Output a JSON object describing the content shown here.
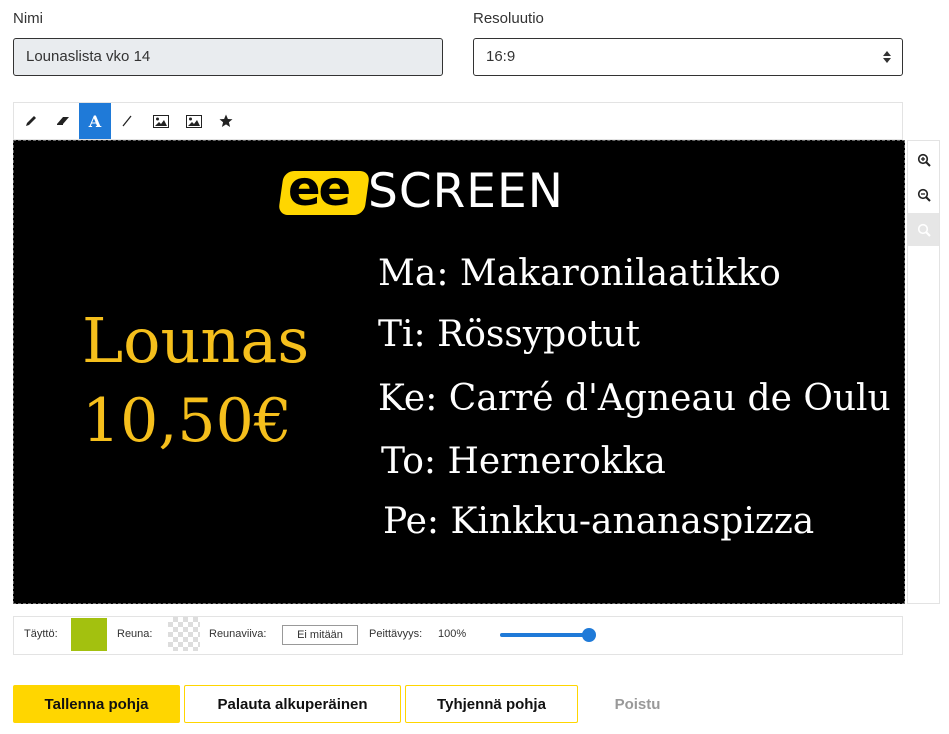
{
  "form": {
    "name_label": "Nimi",
    "name_value": "Lounaslista vko 14",
    "resolution_label": "Resoluutio",
    "resolution_value": "16:9"
  },
  "toolbar": {
    "tools": [
      {
        "name": "pencil-tool",
        "icon": "pencil-icon"
      },
      {
        "name": "eraser-tool",
        "icon": "eraser-icon"
      },
      {
        "name": "text-tool",
        "icon": "text-icon",
        "label": "A",
        "active": true
      },
      {
        "name": "line-tool",
        "icon": "line-icon"
      },
      {
        "name": "image-tool",
        "icon": "image-icon"
      },
      {
        "name": "background-image-tool",
        "icon": "image-icon"
      },
      {
        "name": "shape-tool",
        "icon": "star-icon"
      }
    ]
  },
  "canvas": {
    "logo_badge": "ee",
    "logo_text": "SCREEN",
    "price_title": "Lounas",
    "price_value": "10,50€",
    "menu": [
      "Ma: Makaronilaatikko",
      "Ti: Rössypotut",
      "Ke: Carré d'Agneau de Oulu",
      "To: Hernerokka",
      "Pe: Kinkku-ananaspizza"
    ],
    "colors": {
      "background": "#000000",
      "price": "#f5bf1c",
      "text": "#ffffff",
      "logo_yellow": "#ffd600"
    }
  },
  "zoom": {
    "buttons": [
      "zoom-in-icon",
      "zoom-out-icon",
      "zoom-reset-icon"
    ]
  },
  "settings": {
    "fill_label": "Täyttö:",
    "fill_color": "#a3c10f",
    "border_label": "Reuna:",
    "border_color": "transparent",
    "border_line_label": "Reunaviiva:",
    "border_line_value": "Ei mitään",
    "opacity_label": "Peittävyys:",
    "opacity_value": "100%",
    "opacity_fraction": 1.0
  },
  "actions": {
    "save": "Tallenna pohja",
    "restore": "Palauta alkuperäinen",
    "clear": "Tyhjennä pohja",
    "delete": "Poistu"
  },
  "accent_color": "#1f7ad8",
  "brand_yellow": "#ffd600"
}
